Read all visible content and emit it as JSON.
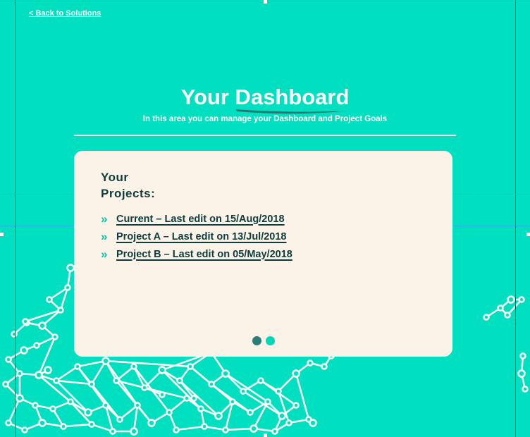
{
  "nav": {
    "back_label": "< Back to Solutions"
  },
  "hero": {
    "title_prefix": "Your",
    "title_accent": "Dashboard",
    "subtitle": "In this area you can manage your Dashboard and Project Goals"
  },
  "card": {
    "heading": "Your Projects:",
    "projects": [
      {
        "label": "Current – Last edit on 15/Aug/2018"
      },
      {
        "label": "Project A – Last edit on 13/Jul/2018"
      },
      {
        "label": "Project B – Last edit on 05/May/2018"
      }
    ],
    "pagination": {
      "pages": 2,
      "current": 1
    }
  },
  "colors": {
    "background": "#00e0c0",
    "card": "#fbf2e8",
    "text_dark": "#0e3b3b",
    "chevron": "#00c9ab",
    "dot_active": "#2b7d78",
    "dot_inactive": "#00d9b8",
    "guide_vertical": "#1a3a4a",
    "guide_horizontal": "#29b6e6"
  },
  "icons": {
    "list_bullet": "double-chevron-right-icon",
    "decoration": "network-graph"
  }
}
